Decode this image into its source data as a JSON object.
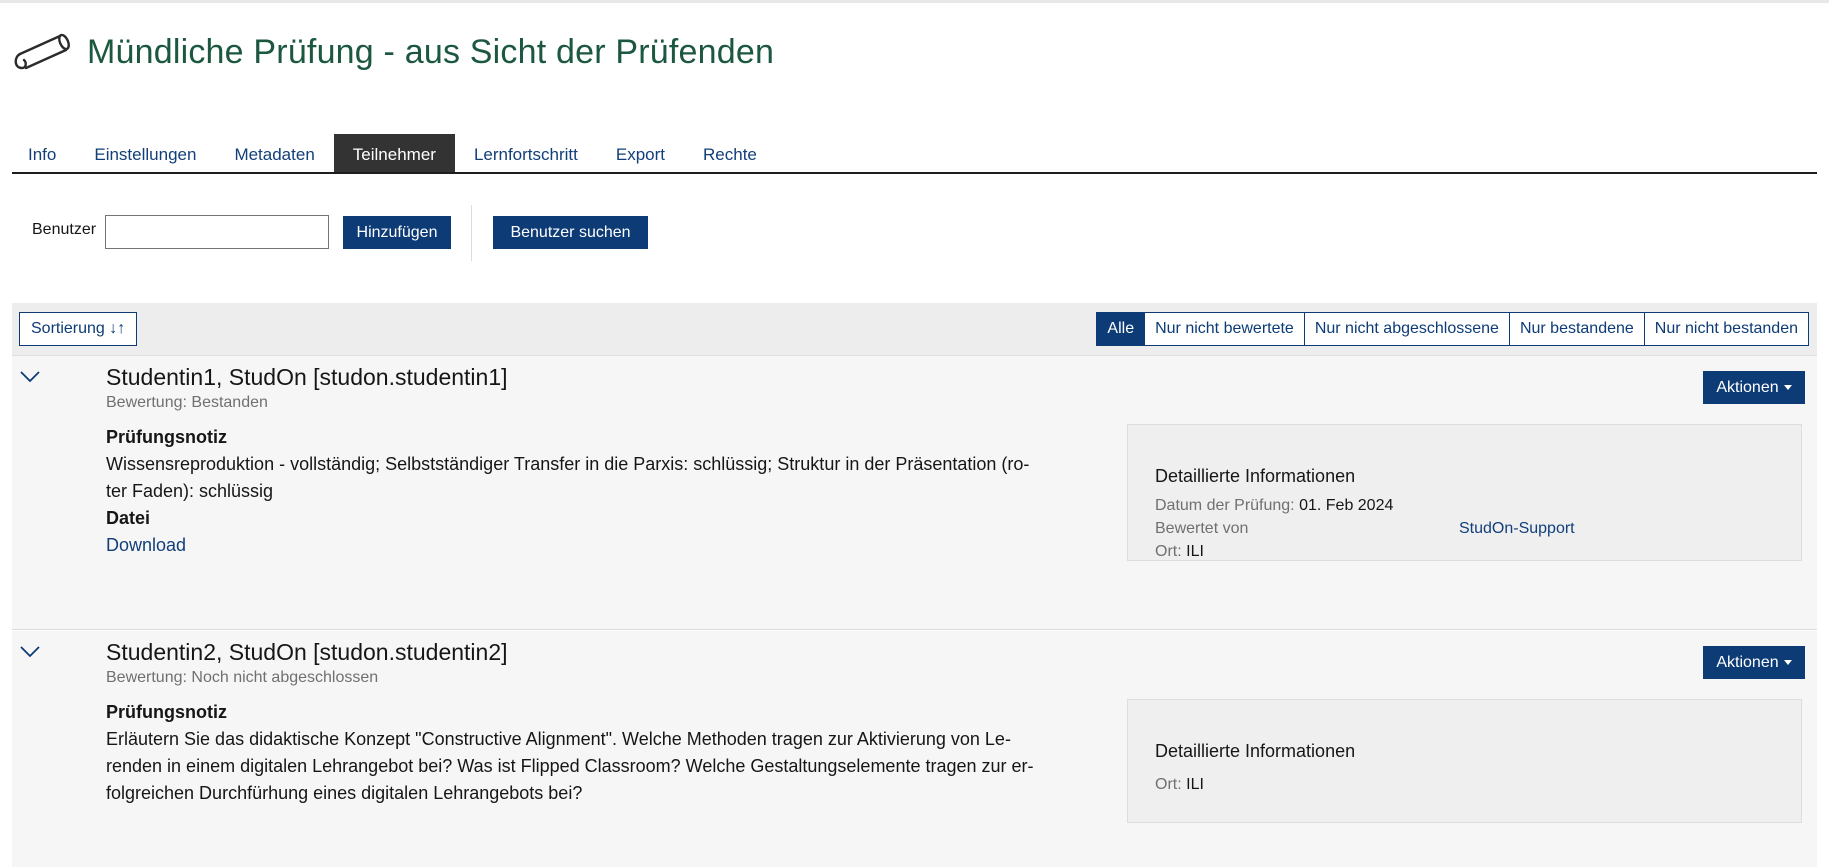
{
  "colors": {
    "brand_title": "#1c5740",
    "primary": "#0d3b76",
    "link": "#123f7a",
    "active_tab": "#333333"
  },
  "page": {
    "title": "Mündliche Prüfung - aus Sicht der Prüfenden",
    "icon": "exam-scroll-icon"
  },
  "tabs": [
    {
      "label": "Info",
      "active": false
    },
    {
      "label": "Einstellungen",
      "active": false
    },
    {
      "label": "Metadaten",
      "active": false
    },
    {
      "label": "Teilnehmer",
      "active": true
    },
    {
      "label": "Lernfortschritt",
      "active": false
    },
    {
      "label": "Export",
      "active": false
    },
    {
      "label": "Rechte",
      "active": false
    }
  ],
  "toolbar": {
    "user_label": "Benutzer",
    "user_value": "",
    "add_button": "Hinzufügen",
    "search_button": "Benutzer suchen"
  },
  "filterbar": {
    "sort_button": "Sortierung ↓↑",
    "filters": [
      {
        "label": "Alle",
        "active": true
      },
      {
        "label": "Nur nicht bewertete",
        "active": false
      },
      {
        "label": "Nur nicht abgeschlossene",
        "active": false
      },
      {
        "label": "Nur bestandene",
        "active": false
      },
      {
        "label": "Nur nicht bestanden",
        "active": false
      }
    ]
  },
  "participants": [
    {
      "name": "Studentin1, StudOn [studon.studentin1]",
      "rating_label": "Bewertung:",
      "rating_value": "Bestanden",
      "actions_label": "Aktionen",
      "note_heading": "Prüfungsnotiz",
      "note_lines": [
        "Wissensreproduktion - vollständig; Selbstständiger Transfer in die Parxis: schlüssig; Struktur in der Präsentation (ro-",
        "ter Faden): schlüssig"
      ],
      "file_heading": "Datei",
      "file_link": "Download",
      "info_heading": "Detaillierte Informationen",
      "date_label": "Datum der Prüfung:",
      "date_value": "01. Feb 2024",
      "graded_by_label": "Bewertet von",
      "graded_by_value": "StudOn-Support",
      "place_label": "Ort:",
      "place_value": "ILI"
    },
    {
      "name": "Studentin2, StudOn [studon.studentin2]",
      "rating_label": "Bewertung:",
      "rating_value": "Noch nicht abgeschlossen",
      "actions_label": "Aktionen",
      "note_heading": "Prüfungsnotiz",
      "note_lines": [
        "Erläutern Sie das didaktische Konzept \"Constructive Alignment\". Welche Methoden tragen zur Aktivierung von Le-",
        "renden in einem digitalen Lehrangebot bei? Was ist Flipped Classroom? Welche Gestaltungselemente tragen zur er-",
        "folgreichen Durchfürhung eines digitalen Lehrangebots bei?"
      ],
      "info_heading": "Detaillierte Informationen",
      "place_label": "Ort:",
      "place_value": "ILI"
    }
  ]
}
